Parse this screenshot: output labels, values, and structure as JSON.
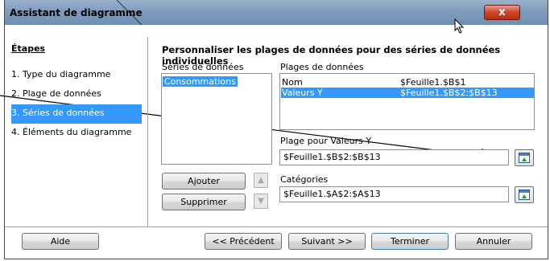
{
  "window": {
    "title": "Assistant de diagramme",
    "close_glyph": "x"
  },
  "steps": {
    "title": "Étapes",
    "items": [
      {
        "label": "1. Type du diagramme"
      },
      {
        "label": "2. Plage de données"
      },
      {
        "label": "3. Séries de données"
      },
      {
        "label": "4. Éléments du diagramme"
      }
    ],
    "active_index": 2
  },
  "main": {
    "heading": "Personnaliser les plages de données pour des séries de données individuelles",
    "series_label": "Séries de données",
    "series_items": [
      "Consommations"
    ],
    "ranges_label": "Plages de données",
    "ranges": [
      {
        "name": "Nom",
        "value": "$Feuille1.$B$1"
      },
      {
        "name": "Valeurs Y",
        "value": "$Feuille1.$B$2:$B$13"
      }
    ],
    "range_for_label": "Plage pour Valeurs Y",
    "range_for_value": "$Feuille1.$B$2:$B$13",
    "categories_label": "Catégories",
    "categories_value": "$Feuille1.$A$2:$A$13",
    "add_button": "Ajouter",
    "remove_button": "Supprimer"
  },
  "footer": {
    "help": "Aide",
    "previous": "<< Précédent",
    "next": "Suivant >>",
    "finish": "Terminer",
    "cancel": "Annuler"
  },
  "colors": {
    "selection": "#3399ff",
    "titlebar": "#7f9cbc",
    "close": "#c8401f"
  }
}
